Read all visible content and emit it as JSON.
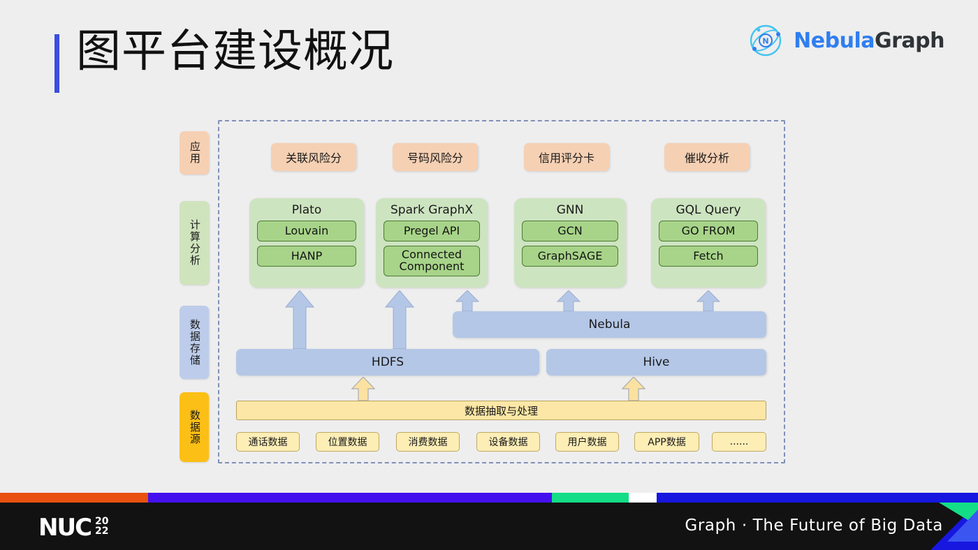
{
  "header": {
    "title": "图平台建设概况",
    "accent_color": "#3b4ee0",
    "logo": {
      "name_primary": "Nebula",
      "name_secondary": "Graph",
      "mark_letter": "N"
    }
  },
  "diagram": {
    "layers": [
      {
        "key": "app",
        "label": "应用",
        "color": "#f6d0b3"
      },
      {
        "key": "comp",
        "label": "计算分析",
        "color": "#cfe4bd"
      },
      {
        "key": "store",
        "label": "数据存储",
        "color": "#bcccea"
      },
      {
        "key": "src",
        "label": "数据源",
        "color": "#fbbf16"
      }
    ],
    "applications": [
      {
        "label": "关联风险分"
      },
      {
        "label": "号码风险分"
      },
      {
        "label": "信用评分卡"
      },
      {
        "label": "催收分析"
      }
    ],
    "compute": [
      {
        "title": "Plato",
        "items": [
          "Louvain",
          "HANP"
        ]
      },
      {
        "title": "Spark GraphX",
        "items": [
          "Pregel API",
          "Connected Component"
        ]
      },
      {
        "title": "GNN",
        "items": [
          "GCN",
          "GraphSAGE"
        ]
      },
      {
        "title": "GQL Query",
        "items": [
          "GO FROM",
          "Fetch"
        ]
      }
    ],
    "storage": {
      "nebula": "Nebula",
      "hdfs": "HDFS",
      "hive": "Hive"
    },
    "source": {
      "pipeline": "数据抽取与处理",
      "chips": [
        "通话数据",
        "位置数据",
        "消费数据",
        "设备数据",
        "用户数据",
        "APP数据",
        "......"
      ]
    }
  },
  "footer": {
    "brand_word": "NUC",
    "year_top": "20",
    "year_bottom": "22",
    "tagline": "Graph · The Future of Big Data",
    "strip_colors": [
      "#e8510f",
      "#4411ee",
      "#13dd86",
      "#ffffff",
      "#1717e0"
    ]
  }
}
